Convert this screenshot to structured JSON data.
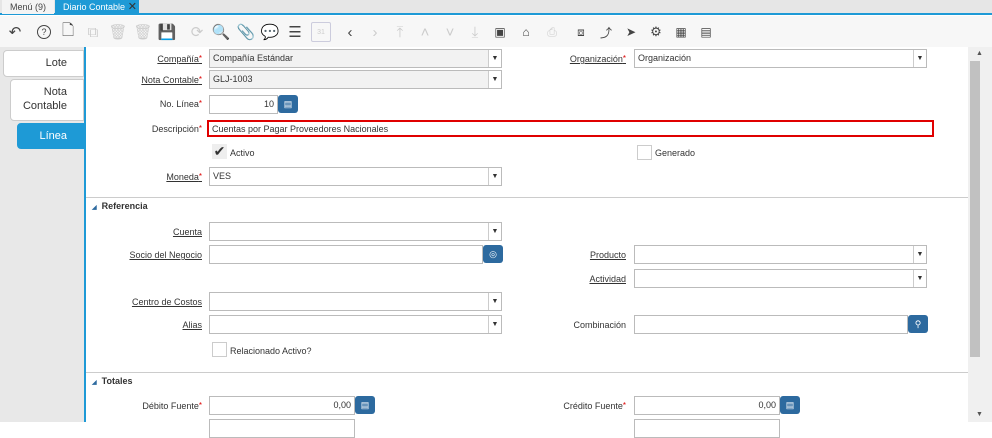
{
  "tabs": [
    {
      "label": "Menú (9)"
    },
    {
      "label": "Diario Contable"
    }
  ],
  "left_tabs": [
    "Lote",
    "Nota Contable",
    "Línea"
  ],
  "left_tabs_split": {
    "nota1": "Nota",
    "nota2": "Contable"
  },
  "fields": {
    "compania": {
      "label": "Compañía",
      "value": "Compañía Estándar"
    },
    "nota": {
      "label": "Nota Contable",
      "value": "GLJ-1003"
    },
    "linea": {
      "label": "No. Línea",
      "value": "10"
    },
    "descripcion": {
      "label": "Descripción",
      "value": "Cuentas por Pagar Proveedores Nacionales"
    },
    "activo": {
      "label": "Activo"
    },
    "generado": {
      "label": "Generado"
    },
    "moneda": {
      "label": "Moneda",
      "value": "VES"
    },
    "organizacion": {
      "label": "Organización",
      "value": "Organización"
    },
    "cuenta": {
      "label": "Cuenta",
      "value": ""
    },
    "socio": {
      "label": "Socio del Negocio",
      "value": ""
    },
    "producto": {
      "label": "Producto",
      "value": ""
    },
    "actividad": {
      "label": "Actividad",
      "value": ""
    },
    "centro": {
      "label": "Centro de Costos",
      "value": ""
    },
    "alias": {
      "label": "Alias",
      "value": ""
    },
    "combinacion": {
      "label": "Combinación",
      "value": ""
    },
    "relacionado": {
      "label": "Relacionado Activo?"
    },
    "debito": {
      "label": "Débito Fuente",
      "value": "0,00"
    },
    "credito": {
      "label": "Crédito Fuente",
      "value": "0,00"
    }
  },
  "sections": {
    "referencia": "Referencia",
    "totales": "Totales"
  },
  "icons": {
    "calendar_day": "31"
  },
  "colors": {
    "accent": "#1e9ad6",
    "button": "#2d6a9f",
    "error": "#e00000"
  }
}
